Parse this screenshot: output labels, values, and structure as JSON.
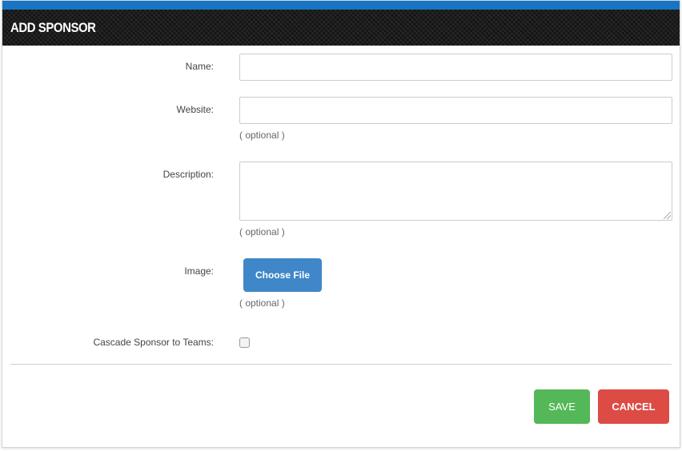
{
  "dialog": {
    "title": "ADD SPONSOR"
  },
  "form": {
    "name_label": "Name:",
    "name_value": "",
    "website_label": "Website:",
    "website_value": "",
    "website_hint": "( optional )",
    "description_label": "Description:",
    "description_value": "",
    "description_hint": "( optional )",
    "image_label": "Image:",
    "image_button": "Choose File",
    "image_hint": "( optional )",
    "cascade_label": "Cascade Sponsor to Teams:",
    "cascade_checked": false
  },
  "actions": {
    "save_label": "SAVE",
    "cancel_label": "CANCEL"
  },
  "colors": {
    "topbar": "#1775c4",
    "header": "#1c1c1c",
    "choose_file": "#3f87c8",
    "save": "#54b858",
    "cancel": "#dd4b45"
  }
}
